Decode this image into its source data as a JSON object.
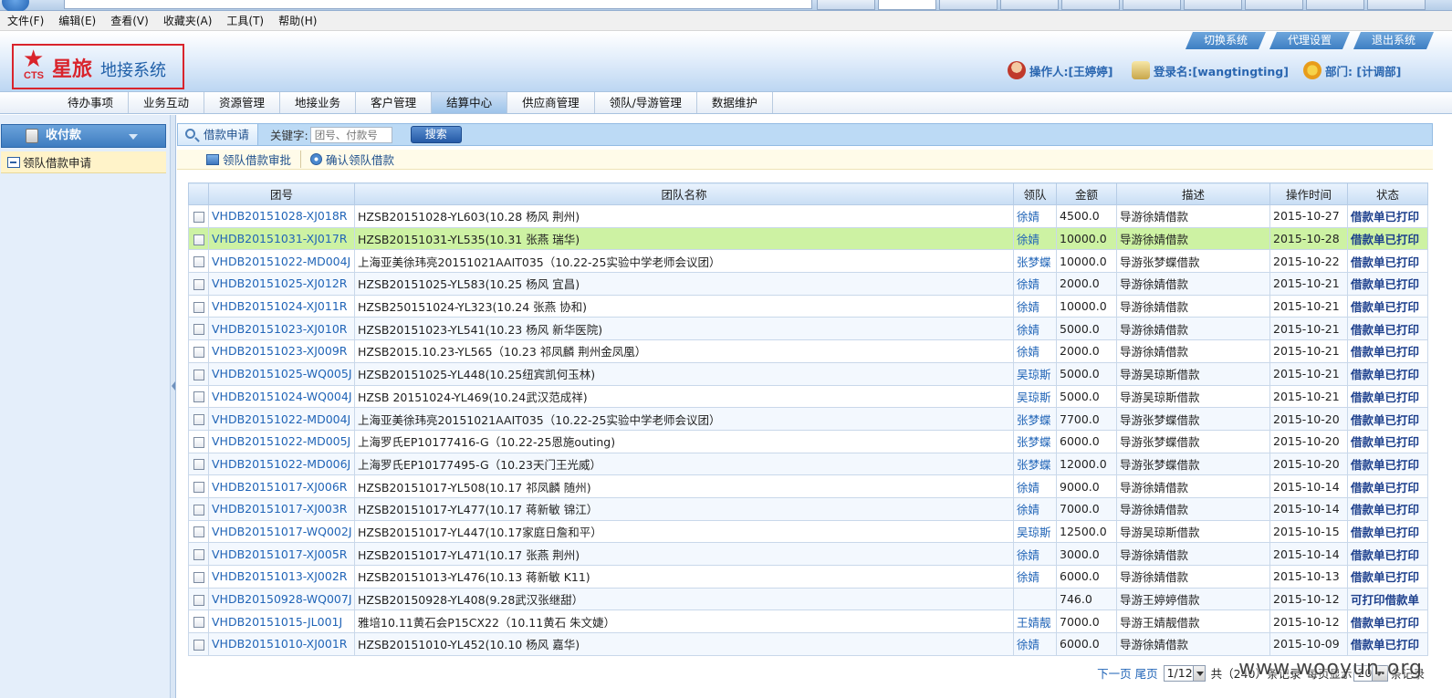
{
  "menubar": [
    "文件(F)",
    "编辑(E)",
    "查看(V)",
    "收藏夹(A)",
    "工具(T)",
    "帮助(H)"
  ],
  "logo": {
    "mark": "CTS",
    "name": "星旅",
    "sub": "地接系统"
  },
  "top_links": [
    "切换系统",
    "代理设置",
    "退出系统"
  ],
  "user": {
    "operator": "操作人:[王婷婷]",
    "login": "登录名:[wangtingting]",
    "dept": "部门: [计调部]"
  },
  "nav": [
    {
      "label": "待办事项",
      "active": false
    },
    {
      "label": "业务互动",
      "active": false
    },
    {
      "label": "资源管理",
      "active": false
    },
    {
      "label": "地接业务",
      "active": false
    },
    {
      "label": "客户管理",
      "active": false
    },
    {
      "label": "结算中心",
      "active": true
    },
    {
      "label": "供应商管理",
      "active": false
    },
    {
      "label": "领队/导游管理",
      "active": false
    },
    {
      "label": "数据维护",
      "active": false
    }
  ],
  "sidebar": {
    "title": "收付款",
    "item": "领队借款申请"
  },
  "toolbar": {
    "tab": "借款申请",
    "keyword_label": "关键字:",
    "keyword_placeholder": "团号、付款号",
    "search": "搜索"
  },
  "actions": [
    "领队借款审批",
    "确认领队借款"
  ],
  "table": {
    "headers": [
      "团号",
      "团队名称",
      "领队",
      "金额",
      "描述",
      "操作时间",
      "状态"
    ],
    "rows": [
      [
        "VHDB20151028-XJ018R",
        "HZSB20151028-YL603(10.28 杨风 荆州)",
        "徐婧",
        "4500.0",
        "导游徐婧借款",
        "2015-10-27",
        "借款单已打印"
      ],
      [
        "VHDB20151031-XJ017R",
        "HZSB20151031-YL535(10.31 张燕 瑞华)",
        "徐婧",
        "10000.0",
        "导游徐婧借款",
        "2015-10-28",
        "借款单已打印"
      ],
      [
        "VHDB20151022-MD004J",
        "上海亚美徐玮亮20151021AAIT035（10.22-25实验中学老师会议团）",
        "张梦蝶",
        "10000.0",
        "导游张梦蝶借款",
        "2015-10-22",
        "借款单已打印"
      ],
      [
        "VHDB20151025-XJ012R",
        "HZSB20151025-YL583(10.25 杨风 宜昌)",
        "徐婧",
        "2000.0",
        "导游徐婧借款",
        "2015-10-21",
        "借款单已打印"
      ],
      [
        "VHDB20151024-XJ011R",
        "HZSB250151024-YL323(10.24 张燕 协和)",
        "徐婧",
        "10000.0",
        "导游徐婧借款",
        "2015-10-21",
        "借款单已打印"
      ],
      [
        "VHDB20151023-XJ010R",
        "HZSB20151023-YL541(10.23 杨风 新华医院)",
        "徐婧",
        "5000.0",
        "导游徐婧借款",
        "2015-10-21",
        "借款单已打印"
      ],
      [
        "VHDB20151023-XJ009R",
        "HZSB2015.10.23-YL565（10.23 祁凤麟 荆州金凤凰）",
        "徐婧",
        "2000.0",
        "导游徐婧借款",
        "2015-10-21",
        "借款单已打印"
      ],
      [
        "VHDB20151025-WQ005J",
        "HZSB20151025-YL448(10.25纽宾凯何玉林)",
        "吴琼斯",
        "5000.0",
        "导游吴琼斯借款",
        "2015-10-21",
        "借款单已打印"
      ],
      [
        "VHDB20151024-WQ004J",
        "HZSB 20151024-YL469(10.24武汉范成祥)",
        "吴琼斯",
        "5000.0",
        "导游吴琼斯借款",
        "2015-10-21",
        "借款单已打印"
      ],
      [
        "VHDB20151022-MD004J",
        "上海亚美徐玮亮20151021AAIT035（10.22-25实验中学老师会议团）",
        "张梦蝶",
        "7700.0",
        "导游张梦蝶借款",
        "2015-10-20",
        "借款单已打印"
      ],
      [
        "VHDB20151022-MD005J",
        "上海罗氏EP10177416-G（10.22-25恩施outing)",
        "张梦蝶",
        "6000.0",
        "导游张梦蝶借款",
        "2015-10-20",
        "借款单已打印"
      ],
      [
        "VHDB20151022-MD006J",
        "上海罗氏EP10177495-G（10.23天门王光威）",
        "张梦蝶",
        "12000.0",
        "导游张梦蝶借款",
        "2015-10-20",
        "借款单已打印"
      ],
      [
        "VHDB20151017-XJ006R",
        "HZSB20151017-YL508(10.17 祁凤麟 随州)",
        "徐婧",
        "9000.0",
        "导游徐婧借款",
        "2015-10-14",
        "借款单已打印"
      ],
      [
        "VHDB20151017-XJ003R",
        "HZSB20151017-YL477(10.17 蒋新敏 锦江）",
        "徐婧",
        "7000.0",
        "导游徐婧借款",
        "2015-10-14",
        "借款单已打印"
      ],
      [
        "VHDB20151017-WQ002J",
        "HZSB20151017-YL447(10.17家庭日詹和平）",
        "吴琼斯",
        "12500.0",
        "导游吴琼斯借款",
        "2015-10-15",
        "借款单已打印"
      ],
      [
        "VHDB20151017-XJ005R",
        "HZSB20151017-YL471(10.17 张燕 荆州)",
        "徐婧",
        "3000.0",
        "导游徐婧借款",
        "2015-10-14",
        "借款单已打印"
      ],
      [
        "VHDB20151013-XJ002R",
        "HZSB20151013-YL476(10.13 蒋新敏 K11)",
        "徐婧",
        "6000.0",
        "导游徐婧借款",
        "2015-10-13",
        "借款单已打印"
      ],
      [
        "VHDB20150928-WQ007J",
        "HZSB20150928-YL408(9.28武汉张继甜）",
        "",
        "746.0",
        "导游王婷婷借款",
        "2015-10-12",
        "可打印借款单"
      ],
      [
        "VHDB20151015-JL001J",
        "雅培10.11黄石会P15CX22（10.11黄石 朱文婕）",
        "王婧靓",
        "7000.0",
        "导游王婧靓借款",
        "2015-10-12",
        "借款单已打印"
      ],
      [
        "VHDB20151010-XJ001R",
        "HZSB20151010-YL452(10.10 杨风 嘉华)",
        "徐婧",
        "6000.0",
        "导游徐婧借款",
        "2015-10-09",
        "借款单已打印"
      ]
    ]
  },
  "pager": {
    "next": "下一页",
    "last": "尾页",
    "page": "1/12",
    "total_prefix": "共（240）条记录",
    "size_label": "每页显示",
    "size": "20",
    "size_suffix": "条记录"
  },
  "watermark": "www.wooyun.org",
  "colors": {
    "accent": "#2064b7",
    "brand_red": "#d9242c",
    "highlight_row": "#cdf2a3"
  }
}
